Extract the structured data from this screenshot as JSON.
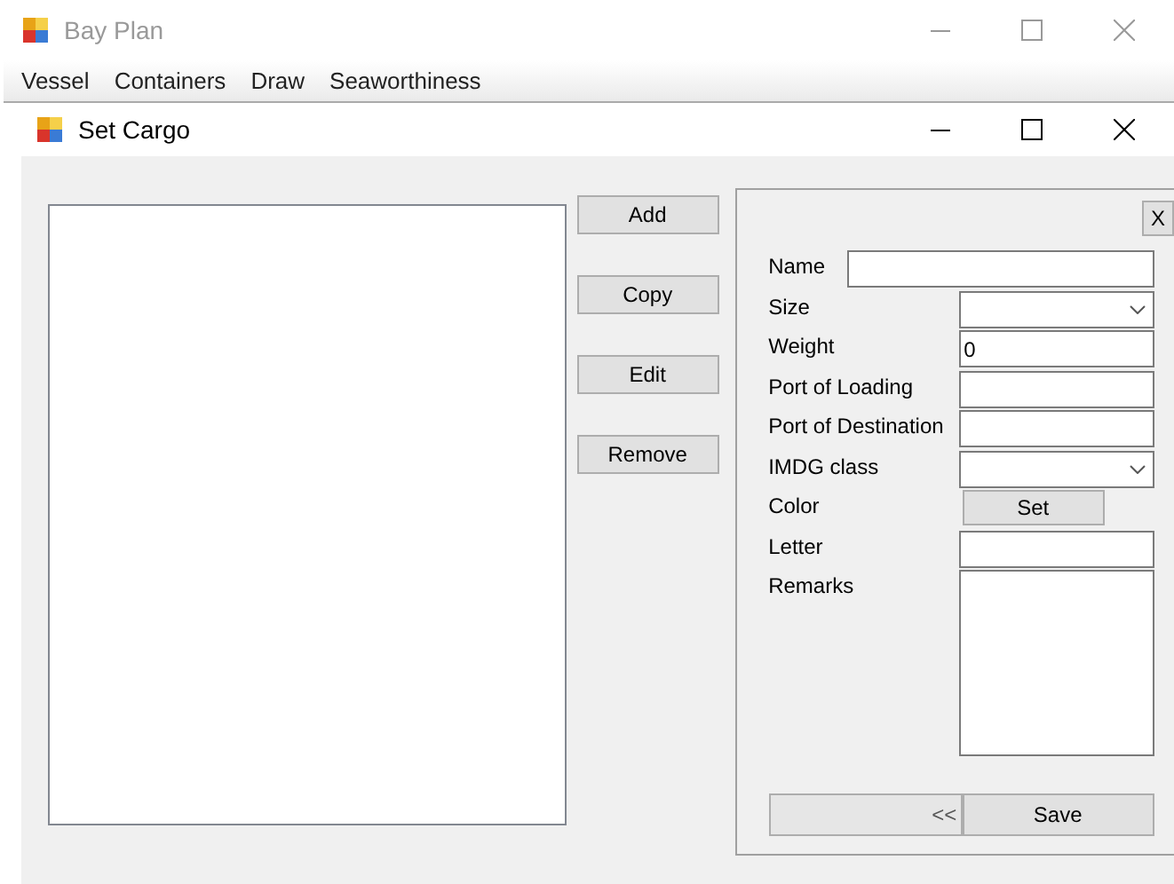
{
  "outer_window": {
    "title": "Bay Plan",
    "active": false
  },
  "menu": [
    {
      "label": "Vessel"
    },
    {
      "label": "Containers"
    },
    {
      "label": "Draw"
    },
    {
      "label": "Seaworthiness"
    }
  ],
  "dialog": {
    "title": "Set Cargo",
    "active": true
  },
  "buttons": [
    "Add",
    "Copy",
    "Edit",
    "Remove"
  ],
  "detail_panel": {
    "close_label": "X",
    "fields": [
      {
        "label": "Name",
        "kind": "wide_text"
      },
      {
        "label": "Size",
        "kind": "combo"
      },
      {
        "label": "Weight",
        "kind": "text",
        "value": "0"
      },
      {
        "label": "Port of Loading",
        "kind": "text"
      },
      {
        "label": "Port of Destination",
        "kind": "text"
      },
      {
        "label": "IMDG class",
        "kind": "combo"
      },
      {
        "label": "Color",
        "kind": "button",
        "button_label": "Set"
      },
      {
        "label": "Letter",
        "kind": "text"
      },
      {
        "label": "Remarks",
        "kind": "textarea"
      }
    ],
    "footer_buttons": [
      "<<",
      "Save"
    ]
  }
}
